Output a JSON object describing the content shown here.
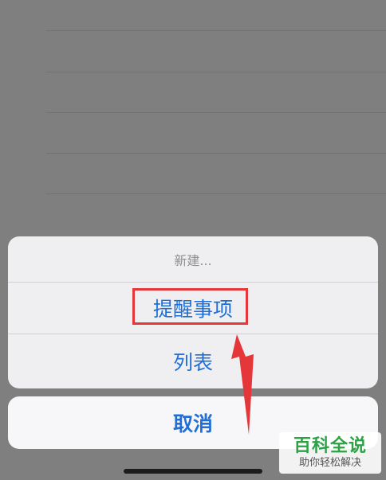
{
  "action_sheet": {
    "title": "新建...",
    "options": [
      {
        "label": "提醒事项"
      },
      {
        "label": "列表"
      }
    ],
    "cancel_label": "取消"
  },
  "annotation": {
    "highlight_color": "#e5363a"
  },
  "watermark": {
    "title": "百科全说",
    "subtitle": "助你轻松解决"
  },
  "colors": {
    "accent": "#1f6fd6",
    "dim_background": "#7f7f7f",
    "watermark_green": "#2ba244"
  }
}
